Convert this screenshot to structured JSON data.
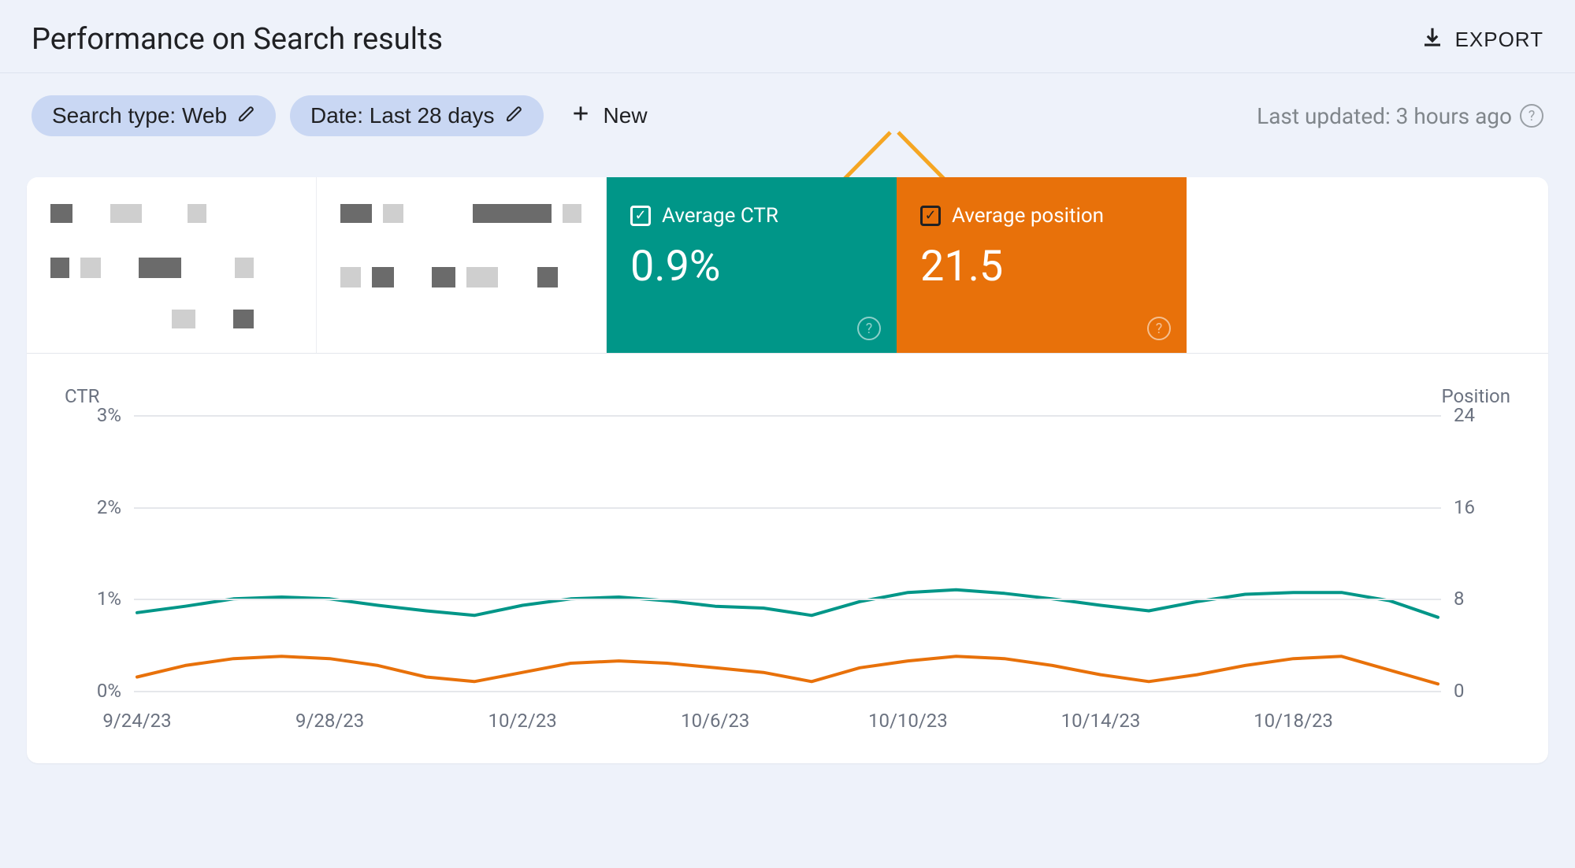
{
  "header": {
    "title": "Performance on Search results",
    "export_label": "EXPORT"
  },
  "filters": {
    "search_type": "Search type: Web",
    "date_range": "Date: Last 28 days",
    "new_label": "New",
    "last_updated": "Last updated: 3 hours ago"
  },
  "metrics": {
    "ctr": {
      "label": "Average CTR",
      "value": "0.9%",
      "checked": true,
      "color": "#009688"
    },
    "position": {
      "label": "Average position",
      "value": "21.5",
      "checked": true,
      "color": "#e8710a"
    }
  },
  "chart_data": {
    "type": "line",
    "title": "",
    "x": [
      "9/24/23",
      "9/25/23",
      "9/26/23",
      "9/27/23",
      "9/28/23",
      "9/29/23",
      "9/30/23",
      "10/1/23",
      "10/2/23",
      "10/3/23",
      "10/4/23",
      "10/5/23",
      "10/6/23",
      "10/7/23",
      "10/8/23",
      "10/9/23",
      "10/10/23",
      "10/11/23",
      "10/12/23",
      "10/13/23",
      "10/14/23",
      "10/15/23",
      "10/16/23",
      "10/17/23",
      "10/18/23",
      "10/19/23",
      "10/20/23",
      "10/21/23"
    ],
    "x_ticks": [
      "9/24/23",
      "9/28/23",
      "10/2/23",
      "10/6/23",
      "10/10/23",
      "10/14/23",
      "10/18/23"
    ],
    "series": [
      {
        "name": "CTR",
        "axis": "left",
        "color": "#009688",
        "values": [
          0.85,
          0.92,
          1.0,
          1.02,
          1.0,
          0.93,
          0.87,
          0.82,
          0.93,
          1.0,
          1.02,
          0.98,
          0.92,
          0.9,
          0.82,
          0.97,
          1.07,
          1.1,
          1.06,
          1.0,
          0.93,
          0.87,
          0.97,
          1.05,
          1.07,
          1.07,
          0.98,
          0.8
        ]
      },
      {
        "name": "Position",
        "axis": "right",
        "color": "#e8710a",
        "values": [
          22.8,
          21.8,
          21.2,
          21.0,
          21.2,
          21.8,
          22.8,
          23.2,
          22.4,
          21.6,
          21.4,
          21.6,
          22.0,
          22.4,
          23.2,
          22.0,
          21.4,
          21.0,
          21.2,
          21.8,
          22.6,
          23.2,
          22.6,
          21.8,
          21.2,
          21.0,
          22.2,
          23.4
        ]
      }
    ],
    "axes": {
      "left": {
        "label": "CTR",
        "ticks": [
          0,
          1,
          2,
          3
        ],
        "tick_labels": [
          "0%",
          "1%",
          "2%",
          "3%"
        ],
        "range": [
          0,
          3
        ]
      },
      "right": {
        "label": "Position",
        "ticks": [
          0,
          8,
          16,
          24
        ],
        "tick_labels": [
          "0",
          "8",
          "16",
          "24"
        ],
        "range": [
          0,
          24
        ],
        "inverted": true
      }
    }
  }
}
